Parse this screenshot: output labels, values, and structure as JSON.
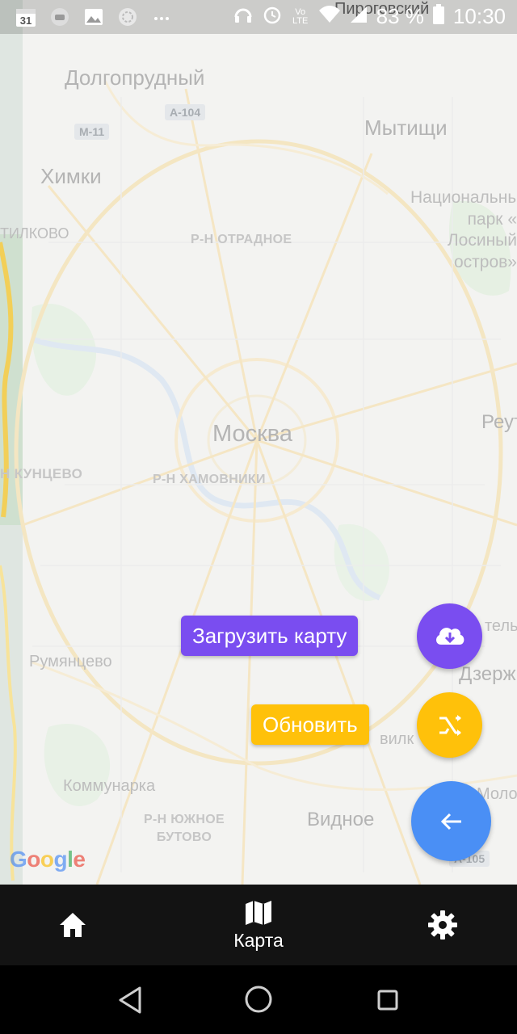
{
  "status_bar": {
    "time": "10:30",
    "battery": "83 %",
    "carrier_peek": "Пироговский",
    "network_label": "Vo LTE",
    "left_icons": [
      "calendar-icon",
      "android-icon",
      "gallery-icon",
      "loading-icon",
      "more-icon"
    ],
    "right_icons": [
      "headphones-icon",
      "alarm-icon",
      "volte-icon",
      "wifi-icon",
      "signal-icon",
      "battery-icon"
    ],
    "calendar_day": "31"
  },
  "map": {
    "labels": {
      "dolgoprudny": "Долгопрудный",
      "khimki": "Химки",
      "mytishchi": "Мытищи",
      "national_park": "Национальный\nпарк «\nЛосиный\nостров»",
      "otradnoe": "Р-Н ОТРАДНОЕ",
      "tushino_cut": "ТИЛКОВО",
      "moscow": "Москва",
      "reutov_cut": "Реут",
      "kuntsevo": "Н КУНЦЕВО",
      "khamovniki": "Р-Н ХАМОВНИКИ",
      "rumyantsevo": "Румянцево",
      "dzerzhinsky_cut": "Дзержин",
      "kotelniki_cut": "тель",
      "vidnoe": "Видное",
      "kommunarka": "Коммунарка",
      "yuzhnoe_butovo": "Р-Н ЮЖНОЕ\nБУТОВО",
      "molokovo_cut": "Моло",
      "vilka_cut": "вилк"
    },
    "road_badges": {
      "a104": "A-104",
      "m11": "M-11",
      "a105": "A-105"
    },
    "attribution": "Google"
  },
  "actions": {
    "download_label": "Загрузить карту",
    "refresh_label": "Обновить",
    "download_color": "#7a4df0",
    "refresh_color": "#ffc10a",
    "back_color": "#4a8ff5"
  },
  "bottom_nav": {
    "items": [
      {
        "name": "home",
        "label": "",
        "icon": "home-icon"
      },
      {
        "name": "map",
        "label": "Карта",
        "icon": "map-icon"
      },
      {
        "name": "settings",
        "label": "",
        "icon": "gear-icon"
      }
    ],
    "active": "map"
  }
}
